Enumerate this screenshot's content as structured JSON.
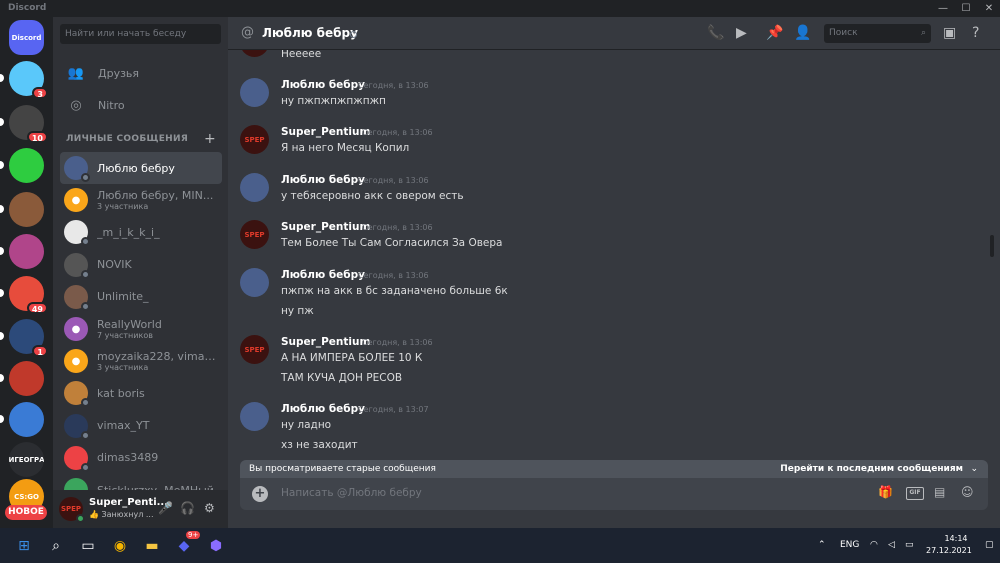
{
  "app": {
    "title": "Discord"
  },
  "window_controls": {
    "minimize": "—",
    "maximize": "☐",
    "close": "✕"
  },
  "guilds": [
    {
      "label": "Discord",
      "color": "#5865f2",
      "badge": ""
    },
    {
      "label": "",
      "color": "#5ac8fa",
      "badge": "3"
    },
    {
      "label": "",
      "color": "#444",
      "badge": "10"
    },
    {
      "label": "",
      "color": "#2ecc40",
      "badge": ""
    },
    {
      "label": "",
      "color": "#8a5a3a",
      "badge": ""
    },
    {
      "label": "",
      "color": "#b0458a",
      "badge": ""
    },
    {
      "label": "",
      "color": "#e74c3c",
      "badge": "49"
    },
    {
      "label": "",
      "color": "#2c4a7a",
      "badge": "1"
    },
    {
      "label": "",
      "color": "#c0392b",
      "badge": ""
    },
    {
      "label": "",
      "color": "#3a7bd5",
      "badge": ""
    },
    {
      "label": "СИГЕОГРАС",
      "color": "#2b2d31",
      "badge": ""
    },
    {
      "label": "CS:GO",
      "color": "#f39c12",
      "badge": ""
    }
  ],
  "new_badge": "НОВОЕ",
  "dm_search": {
    "placeholder": "Найти или начать беседу"
  },
  "nav": {
    "friends": "Друзья",
    "nitro": "Nitro"
  },
  "dm_section": {
    "title": "ЛИЧНЫЕ СООБЩЕНИЯ",
    "add": "+"
  },
  "dms": [
    {
      "name": "Люблю бебру",
      "sub": "",
      "color": "#4a5f8c",
      "active": true
    },
    {
      "name": "Люблю бебру, MIN...",
      "sub": "3 участника",
      "color": "#faa61a",
      "active": false
    },
    {
      "name": "_m_i_k_k_i_",
      "sub": "",
      "color": "#e8e8e8",
      "active": false
    },
    {
      "name": "NOVIK",
      "sub": "",
      "color": "#555",
      "active": false
    },
    {
      "name": "Unlimite_",
      "sub": "",
      "color": "#7a5a4a",
      "active": false
    },
    {
      "name": "ReallyWorld",
      "sub": "7 участников",
      "color": "#9b59b6",
      "active": false
    },
    {
      "name": "moyzaika228, vimax...",
      "sub": "3 участника",
      "color": "#faa61a",
      "active": false
    },
    {
      "name": "kat boris",
      "sub": "",
      "color": "#c0803a",
      "active": false
    },
    {
      "name": "vimax_YT",
      "sub": "",
      "color": "#2a3a5a",
      "active": false
    },
    {
      "name": "dimas3489",
      "sub": "",
      "color": "#ed4245",
      "active": false
    },
    {
      "name": "Sticklurzxy, МеМНый",
      "sub": "",
      "color": "#3ba55d",
      "active": false
    }
  ],
  "user": {
    "name": "Super_Penti...",
    "status": "👍 Занюхнул ...",
    "avatar_text": "SPEP"
  },
  "header": {
    "title": "Люблю бебру",
    "search_placeholder": "Поиск"
  },
  "messages": [
    {
      "author": "",
      "time": "",
      "lines": [
        "Нееееe"
      ],
      "avatar": "lb"
    },
    {
      "author": "Люблю бебру",
      "time": "Сегодня, в 13:06",
      "lines": [
        "ну пжпжпжпжпжп"
      ],
      "avatar": "lb"
    },
    {
      "author": "Super_Pentium",
      "time": "Сегодня, в 13:06",
      "lines": [
        "Я на него Месяц Копил"
      ],
      "avatar": "sp"
    },
    {
      "author": "Люблю бебру",
      "time": "Сегодня, в 13:06",
      "lines": [
        "у тебясеровно акк с овером есть"
      ],
      "avatar": "lb"
    },
    {
      "author": "Super_Pentium",
      "time": "Сегодня, в 13:06",
      "lines": [
        "Тем Более Ты Сам Согласился За Овера"
      ],
      "avatar": "sp"
    },
    {
      "author": "Люблю бебру",
      "time": "Сегодня, в 13:06",
      "lines": [
        "пжпж на акк в бс заданачено больше 6к",
        "ну пж"
      ],
      "avatar": "lb"
    },
    {
      "author": "Super_Pentium",
      "time": "Сегодня, в 13:06",
      "lines": [
        "А НА ИМПЕРА БОЛЕЕ 10  К",
        "ТАМ КУЧА ДОН РЕСОВ"
      ],
      "avatar": "sp"
    },
    {
      "author": "Люблю бебру",
      "time": "Сегодня, в 13:07",
      "lines": [
        "ну ладно",
        "хз не заходит"
      ],
      "avatar": "lb"
    }
  ],
  "old_messages_bar": {
    "left": "Вы просматриваете старые сообщения",
    "right": "Перейти к последним сообщениям"
  },
  "composer": {
    "placeholder": "Написать @Люблю бебру",
    "gif": "GIF"
  },
  "taskbar": {
    "lang": "ENG",
    "time": "14:14",
    "date": "27.12.2021",
    "discord_badge": "9+"
  }
}
